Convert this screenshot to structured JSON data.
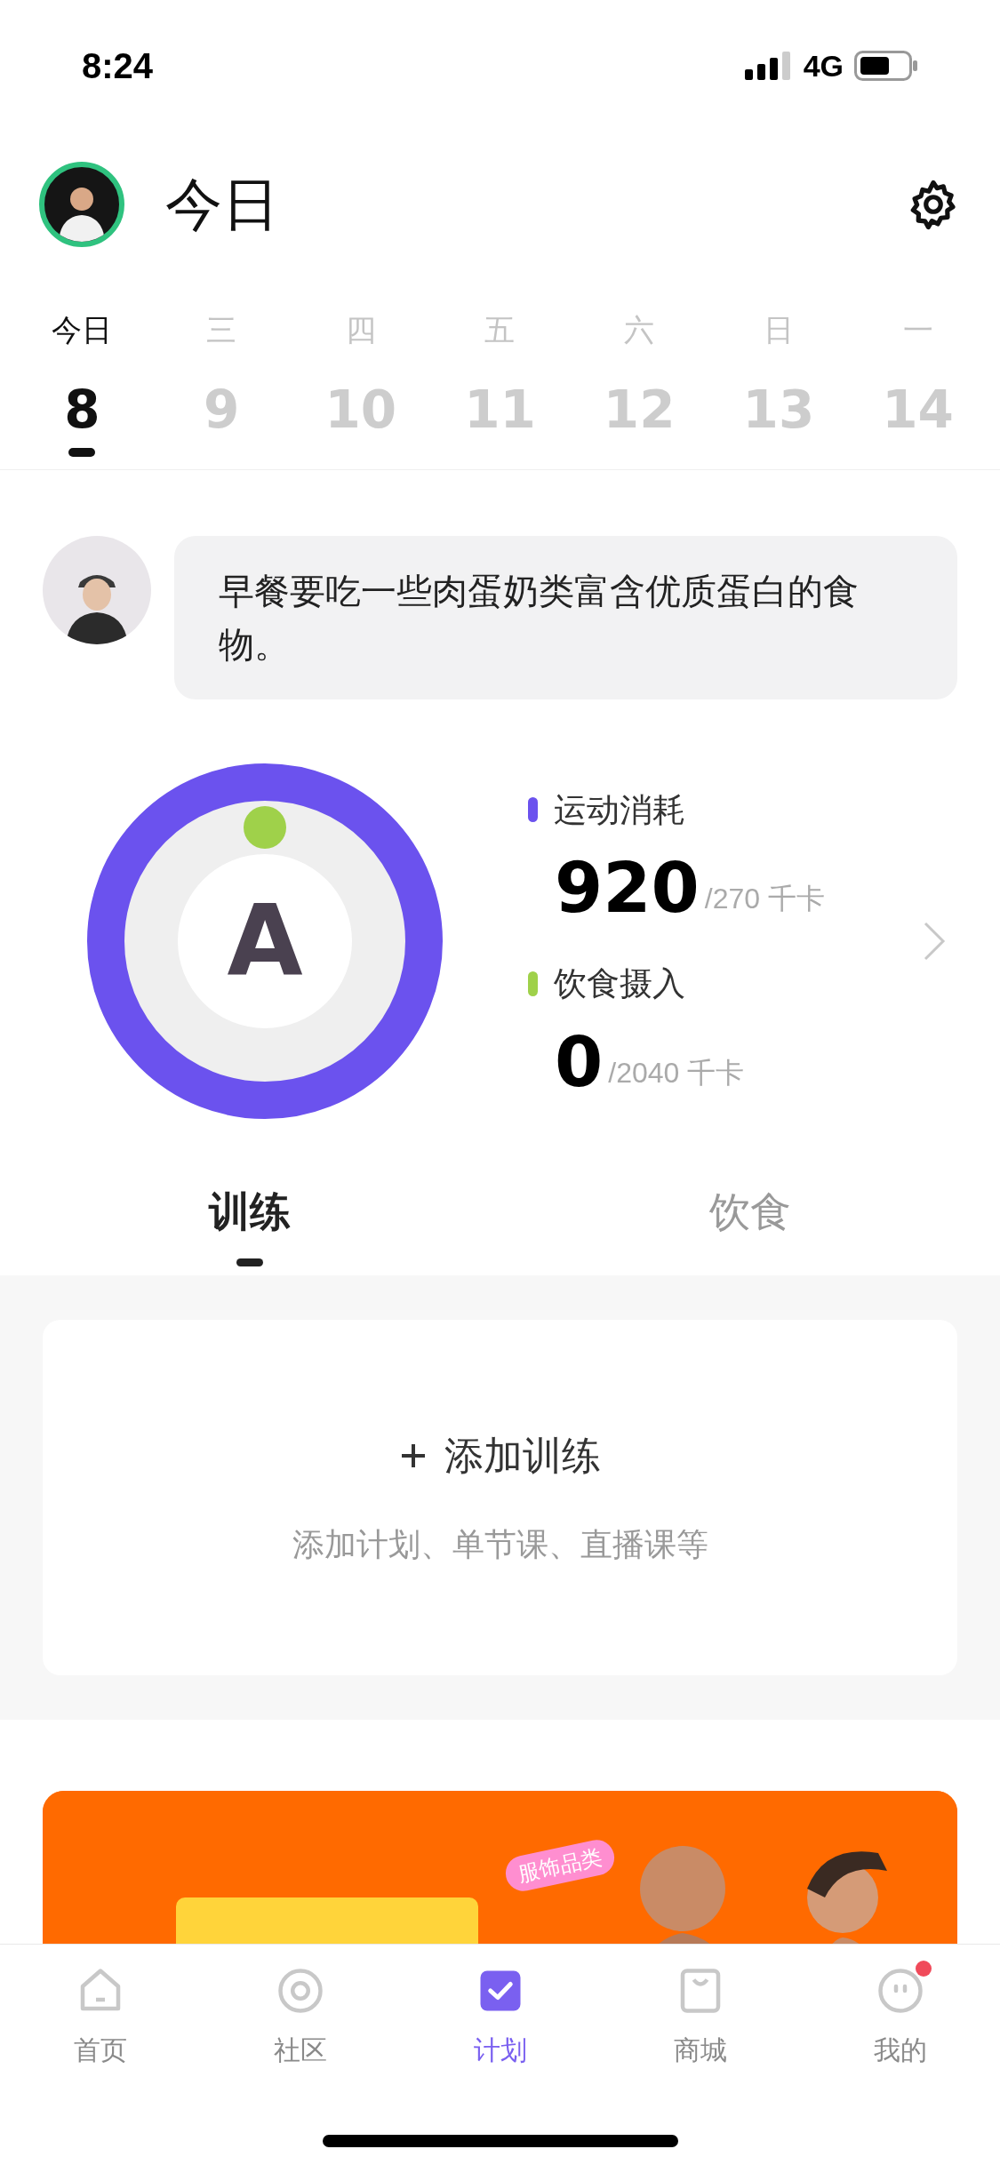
{
  "status_bar": {
    "time": "8:24",
    "network": "4G"
  },
  "header": {
    "title": "今日"
  },
  "week": [
    {
      "weekday": "今日",
      "date": "8",
      "selected": true
    },
    {
      "weekday": "三",
      "date": "9",
      "selected": false
    },
    {
      "weekday": "四",
      "date": "10",
      "selected": false
    },
    {
      "weekday": "五",
      "date": "11",
      "selected": false
    },
    {
      "weekday": "六",
      "date": "12",
      "selected": false
    },
    {
      "weekday": "日",
      "date": "13",
      "selected": false
    },
    {
      "weekday": "一",
      "date": "14",
      "selected": false
    }
  ],
  "tip": {
    "message": "早餐要吃一些肉蛋奶类富含优质蛋白的食物。"
  },
  "summary": {
    "grade": "A",
    "ring": {
      "level": 1
    },
    "stats": [
      {
        "label": "运动消耗",
        "value": "920",
        "target": "/270 千卡",
        "color": "#6b52ee"
      },
      {
        "label": "饮食摄入",
        "value": "0",
        "target": "/2040 千卡",
        "color": "#9fd14a"
      }
    ]
  },
  "tabs": [
    {
      "label": "训练",
      "selected": true
    },
    {
      "label": "饮食",
      "selected": false
    }
  ],
  "training_card": {
    "action": "添加训练",
    "hint": "添加计划、单节课、直播课等"
  },
  "banner": {
    "kind": "picture",
    "tag": "服饰品类"
  },
  "tab_bar": [
    {
      "label": "首页",
      "kind": "home",
      "selected": false,
      "badge": false
    },
    {
      "label": "社区",
      "kind": "community",
      "selected": false,
      "badge": false
    },
    {
      "label": "计划",
      "kind": "plan",
      "selected": true,
      "badge": false
    },
    {
      "label": "商城",
      "kind": "shop",
      "selected": false,
      "badge": false
    },
    {
      "label": "我的",
      "kind": "me",
      "selected": false,
      "badge": true
    }
  ]
}
